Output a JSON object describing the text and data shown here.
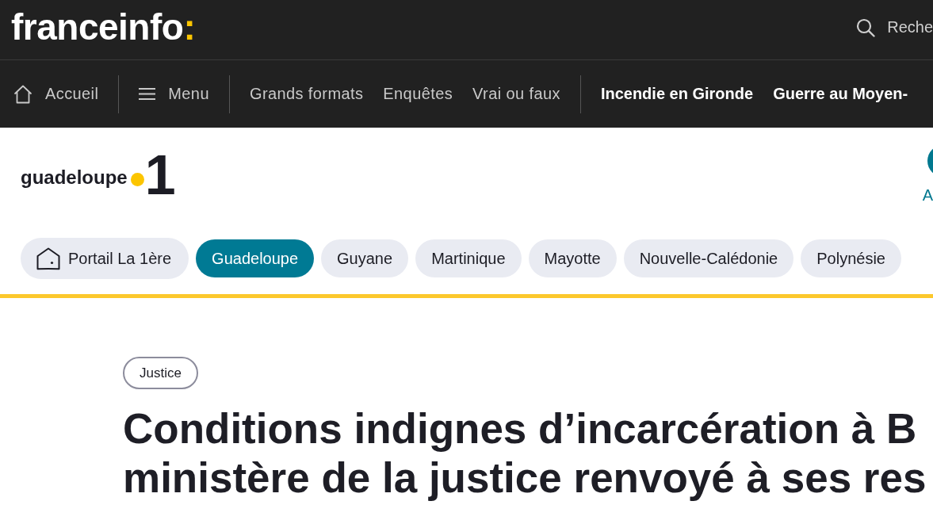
{
  "header": {
    "logo": {
      "text": "franceinfo",
      "accent": ":"
    },
    "search": {
      "label": "Reche"
    }
  },
  "nav": {
    "groups": [
      {
        "kind": "section",
        "items": [
          {
            "label": "Accueil",
            "kind": "home"
          }
        ]
      },
      {
        "kind": "section",
        "items": [
          {
            "label": "Menu",
            "kind": "menu"
          }
        ]
      },
      {
        "kind": "section",
        "items": [
          {
            "label": "Grands formats",
            "kind": "link"
          },
          {
            "label": "Enquêtes",
            "kind": "link"
          },
          {
            "label": "Vrai ou faux",
            "kind": "link"
          }
        ]
      },
      {
        "kind": "topics",
        "items": [
          {
            "label": "Incendie en Gironde",
            "kind": "link"
          },
          {
            "label": "Guerre au Moyen-",
            "kind": "link"
          }
        ]
      }
    ]
  },
  "region": {
    "logo": {
      "name": "guadeloupe",
      "number": "1"
    },
    "account": {
      "label": "A"
    }
  },
  "chips": [
    {
      "label": "Portail La 1ère",
      "kind": "portal",
      "selected": false
    },
    {
      "label": "Guadeloupe",
      "kind": "region",
      "selected": true
    },
    {
      "label": "Guyane",
      "kind": "region",
      "selected": false
    },
    {
      "label": "Martinique",
      "kind": "region",
      "selected": false
    },
    {
      "label": "Mayotte",
      "kind": "region",
      "selected": false
    },
    {
      "label": "Nouvelle-Calédonie",
      "kind": "region",
      "selected": false
    },
    {
      "label": "Polynésie",
      "kind": "region",
      "selected": false
    }
  ],
  "article": {
    "tag": "Justice",
    "title_lines": [
      "Conditions indignes d’incarcération à B",
      "ministère de la justice renvoyé à ses res"
    ]
  }
}
